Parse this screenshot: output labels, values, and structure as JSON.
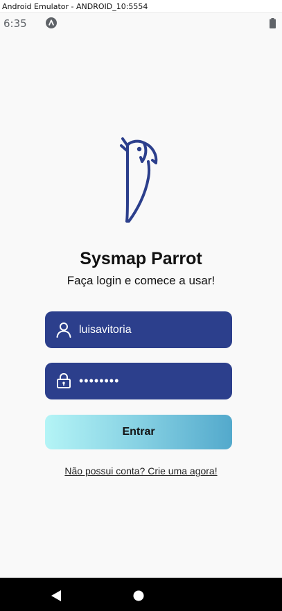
{
  "window": {
    "title": "Android Emulator - ANDROID_10:5554"
  },
  "status_bar": {
    "time": "6:35",
    "notification_icon": "android-a-icon",
    "battery_icon": "battery-icon"
  },
  "app": {
    "logo_icon": "parrot-logo-icon",
    "title": "Sysmap Parrot",
    "subtitle": "Faça login e comece a usar!"
  },
  "form": {
    "username": {
      "value": "luisavitoria",
      "icon": "user-icon"
    },
    "password": {
      "value": "••••••••",
      "icon": "lock-icon"
    },
    "submit_label": "Entrar",
    "signup_link": "Não possui conta? Crie uma agora!"
  },
  "nav_bar": {
    "back_icon": "back-triangle-icon",
    "home_icon": "home-circle-icon"
  },
  "colors": {
    "field_bg": "#2c3f8c",
    "button_gradient_start": "#b4f4f6",
    "button_gradient_end": "#53a9cc",
    "background": "#f9f9f9"
  }
}
